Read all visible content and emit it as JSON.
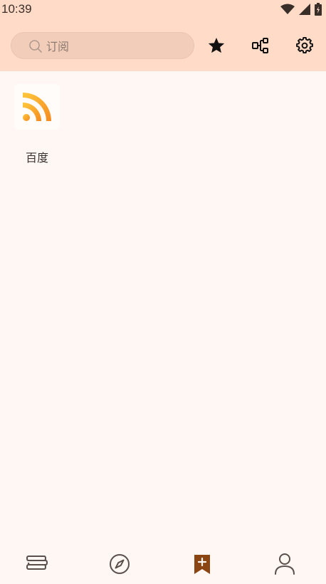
{
  "status_bar": {
    "time": "10:39",
    "icons": [
      "wifi-icon",
      "signal-icon",
      "battery-icon"
    ]
  },
  "header": {
    "search": {
      "placeholder": "订阅",
      "value": ""
    },
    "actions": [
      "star-icon",
      "tree-structure-icon",
      "gear-icon"
    ]
  },
  "feeds": [
    {
      "name": "百度",
      "icon": "rss-icon"
    }
  ],
  "bottom_nav": [
    {
      "id": "bookshelf",
      "icon": "books-icon"
    },
    {
      "id": "discover",
      "icon": "compass-icon"
    },
    {
      "id": "subscribe",
      "icon": "bookmark-plus-icon",
      "active": true
    },
    {
      "id": "profile",
      "icon": "person-icon"
    }
  ],
  "colors": {
    "header_bg": "#ffdbc8",
    "page_bg": "#fff7f3",
    "accent": "#8b4513",
    "rss_orange": "#f7931e"
  }
}
